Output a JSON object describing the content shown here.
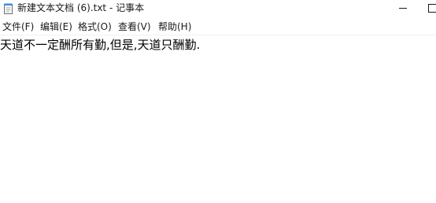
{
  "window": {
    "title": "新建文本文档 (6).txt - 记事本"
  },
  "menu": {
    "file": "文件(F)",
    "edit": "编辑(E)",
    "format": "格式(O)",
    "view": "查看(V)",
    "help": "帮助(H)"
  },
  "editor": {
    "content": "天道不一定酬所有勤,但是,天道只酬勤."
  },
  "icons": {
    "app": "notepad-icon",
    "minimize": "minimize-icon",
    "maximize": "maximize-icon"
  },
  "colors": {
    "background": "#ffffff",
    "text": "#000000",
    "icon_blue": "#3c8fd8"
  }
}
